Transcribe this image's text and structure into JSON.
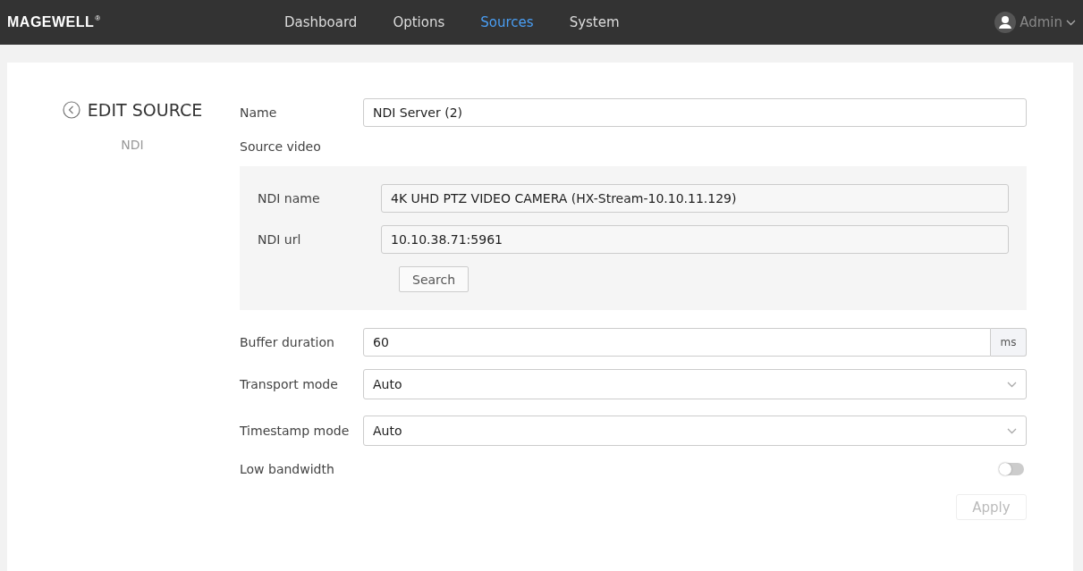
{
  "header": {
    "logo": "MAGEWELL",
    "logo_mark": "®",
    "nav": [
      {
        "label": "Dashboard",
        "selected": false
      },
      {
        "label": "Options",
        "selected": false
      },
      {
        "label": "Sources",
        "selected": true
      },
      {
        "label": "System",
        "selected": false
      }
    ],
    "user": "Admin"
  },
  "sidebar": {
    "title": "EDIT SOURCE",
    "subtitle": "NDI"
  },
  "form": {
    "name": {
      "label": "Name",
      "value": "NDI Server (2)"
    },
    "source_video": {
      "label": "Source video",
      "ndi_name": {
        "label": "NDI name",
        "value": "4K UHD PTZ VIDEO CAMERA (HX-Stream-10.10.11.129)"
      },
      "ndi_url": {
        "label": "NDI url",
        "value": "10.10.38.71:5961"
      },
      "search_button": "Search"
    },
    "buffer_duration": {
      "label": "Buffer duration",
      "value": "60",
      "unit": "ms"
    },
    "transport_mode": {
      "label": "Transport mode",
      "value": "Auto"
    },
    "timestamp_mode": {
      "label": "Timestamp mode",
      "value": "Auto"
    },
    "low_bandwidth": {
      "label": "Low bandwidth",
      "on": false
    },
    "apply_button": {
      "label": "Apply",
      "disabled": true
    }
  }
}
